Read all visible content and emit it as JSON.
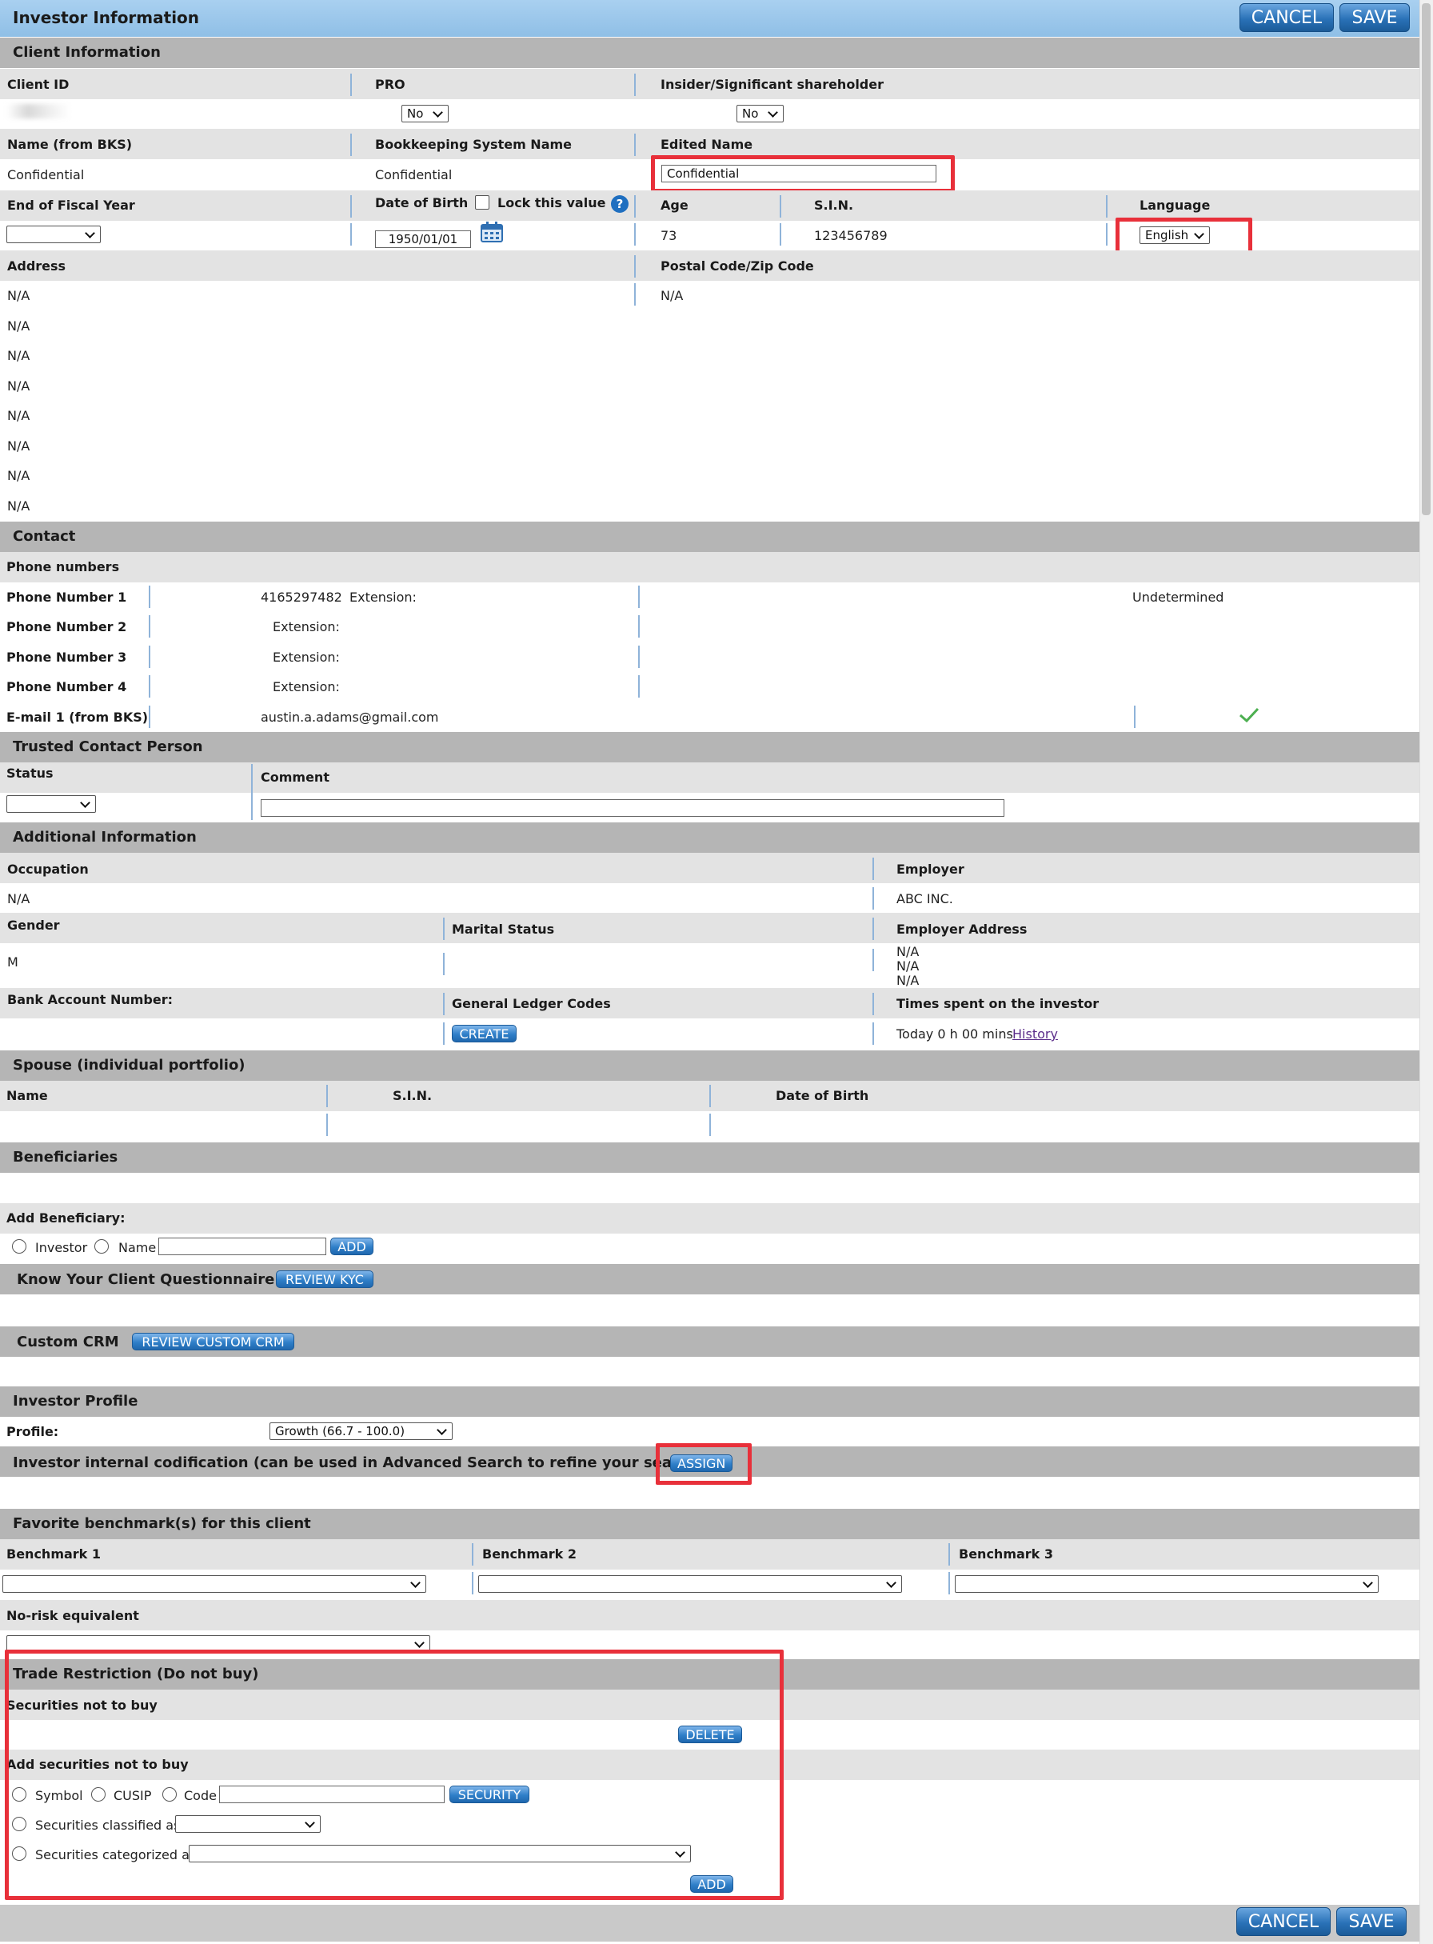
{
  "top": {
    "title": "Investor Information",
    "cancel": "CANCEL",
    "save": "SAVE"
  },
  "client": {
    "header": "Client Information",
    "client_id_label": "Client ID",
    "pro_label": "PRO",
    "pro_value": "No",
    "insider_label": "Insider/Significant shareholder",
    "insider_value": "No",
    "name_bks_label": "Name (from BKS)",
    "name_bks_value": "Confidential",
    "bks_name_label": "Bookkeeping System Name",
    "bks_name_value": "Confidential",
    "edited_name_label": "Edited Name",
    "edited_name_value": "Confidential",
    "fiscal_label": "End of Fiscal Year",
    "dob_label": "Date of Birth",
    "lock_label": "Lock this value",
    "dob_value": "1950/01/01",
    "age_label": "Age",
    "age_value": "73",
    "sin_label": "S.I.N.",
    "sin_value": "123456789",
    "language_label": "Language",
    "language_value": "English",
    "address_label": "Address",
    "address_lines": [
      "N/A",
      "N/A",
      "N/A",
      "N/A",
      "N/A",
      "N/A",
      "N/A",
      "N/A"
    ],
    "postal_label": "Postal Code/Zip Code",
    "postal_value": "N/A"
  },
  "contact": {
    "header": "Contact",
    "phone_numbers_label": "Phone numbers",
    "phones": [
      {
        "label": "Phone Number 1",
        "number": "4165297482",
        "ext": "Extension:"
      },
      {
        "label": "Phone Number 2",
        "number": "",
        "ext": "Extension:"
      },
      {
        "label": "Phone Number 3",
        "number": "",
        "ext": "Extension:"
      },
      {
        "label": "Phone Number 4",
        "number": "",
        "ext": "Extension:"
      }
    ],
    "phone1_status": "Undetermined",
    "email_label": "E-mail 1 (from BKS)",
    "email_value": "austin.a.adams@gmail.com"
  },
  "trusted": {
    "header": "Trusted Contact Person",
    "status_label": "Status",
    "comment_label": "Comment"
  },
  "additional": {
    "header": "Additional Information",
    "occupation_label": "Occupation",
    "occupation_value": "N/A",
    "employer_label": "Employer",
    "employer_value": "ABC INC.",
    "gender_label": "Gender",
    "gender_value": "M",
    "marital_label": "Marital Status",
    "employer_address_label": "Employer Address",
    "employer_address_lines": [
      "N/A",
      "N/A",
      "N/A"
    ],
    "bank_label": "Bank Account Number:",
    "gl_label": "General Ledger Codes",
    "create": "CREATE",
    "time_label": "Times spent on the investor",
    "time_value": "Today 0 h 00 mins",
    "history": "History"
  },
  "spouse": {
    "header": "Spouse (individual portfolio)",
    "name_label": "Name",
    "sin_label": "S.I.N.",
    "dob_label": "Date of Birth"
  },
  "beneficiaries": {
    "header": "Beneficiaries",
    "add_label": "Add Beneficiary:",
    "investor": "Investor",
    "name": "Name",
    "add": "ADD"
  },
  "kyc": {
    "label": "Know Your Client Questionnaire",
    "button": "REVIEW KYC"
  },
  "crm": {
    "label": "Custom CRM",
    "button": "REVIEW CUSTOM CRM"
  },
  "profile": {
    "header": "Investor Profile",
    "label": "Profile:",
    "value": "Growth (66.7 - 100.0)"
  },
  "codification": {
    "label": "Investor internal codification (can be used in Advanced Search to refine your search)",
    "button": "ASSIGN"
  },
  "benchmarks": {
    "header": "Favorite benchmark(s) for this client",
    "b1": "Benchmark 1",
    "b2": "Benchmark 2",
    "b3": "Benchmark 3",
    "norisk": "No-risk equivalent"
  },
  "trade": {
    "header": "Trade Restriction (Do not buy)",
    "not_to_buy": "Securities not to buy",
    "delete": "DELETE",
    "add_label": "Add securities not to buy",
    "symbol": "Symbol",
    "cusip": "CUSIP",
    "code": "Code",
    "security": "SECURITY",
    "classified": "Securities classified as",
    "categorized": "Securities categorized as",
    "add": "ADD"
  },
  "bottom": {
    "cancel": "CANCEL",
    "save": "SAVE"
  },
  "colors": {
    "accent": "#2f7fc8",
    "highlight": "#e8303a",
    "header_bar": "#8fbfe6",
    "check": "#4caf50"
  }
}
